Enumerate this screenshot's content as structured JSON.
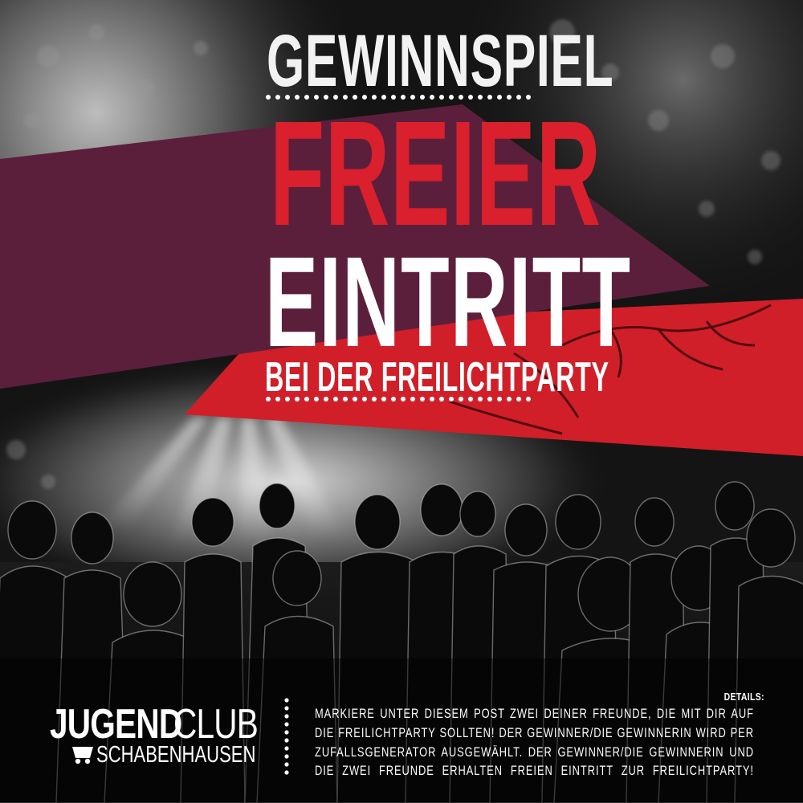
{
  "poster": {
    "kicker": "GEWINNSPIEL",
    "headline_line1": "FREIER",
    "headline_line2": "EINTRITT",
    "subline": "BEI DER FREILICHTPARTY"
  },
  "logo": {
    "word_bold": "JUGEND",
    "word_regular": "CLUB",
    "place": "SCHABENHAUSEN"
  },
  "details": {
    "label": "DETAILS:",
    "text": "MARKIERE UNTER DIESEM POST ZWEI DEINER FREUNDE, DIE MIT DIR AUF DIE FREILICHTPARTY SOLLTEN! DER GEWINNER/DIE GEWINNERIN WIRD PER ZUFALLSGENERATOR AUSGEWÄHLT. DER GEWINNER/DIE GEWINNERIN UND DIE ZWEI FREUNDE ERHALTEN FREIEN EINTRITT ZUR FREILICHTPARTY!"
  },
  "colors": {
    "plum_band": "#5b1f3c",
    "red_band": "#d01f29",
    "headline_red": "#d9202c",
    "text_white": "#ffffff"
  }
}
